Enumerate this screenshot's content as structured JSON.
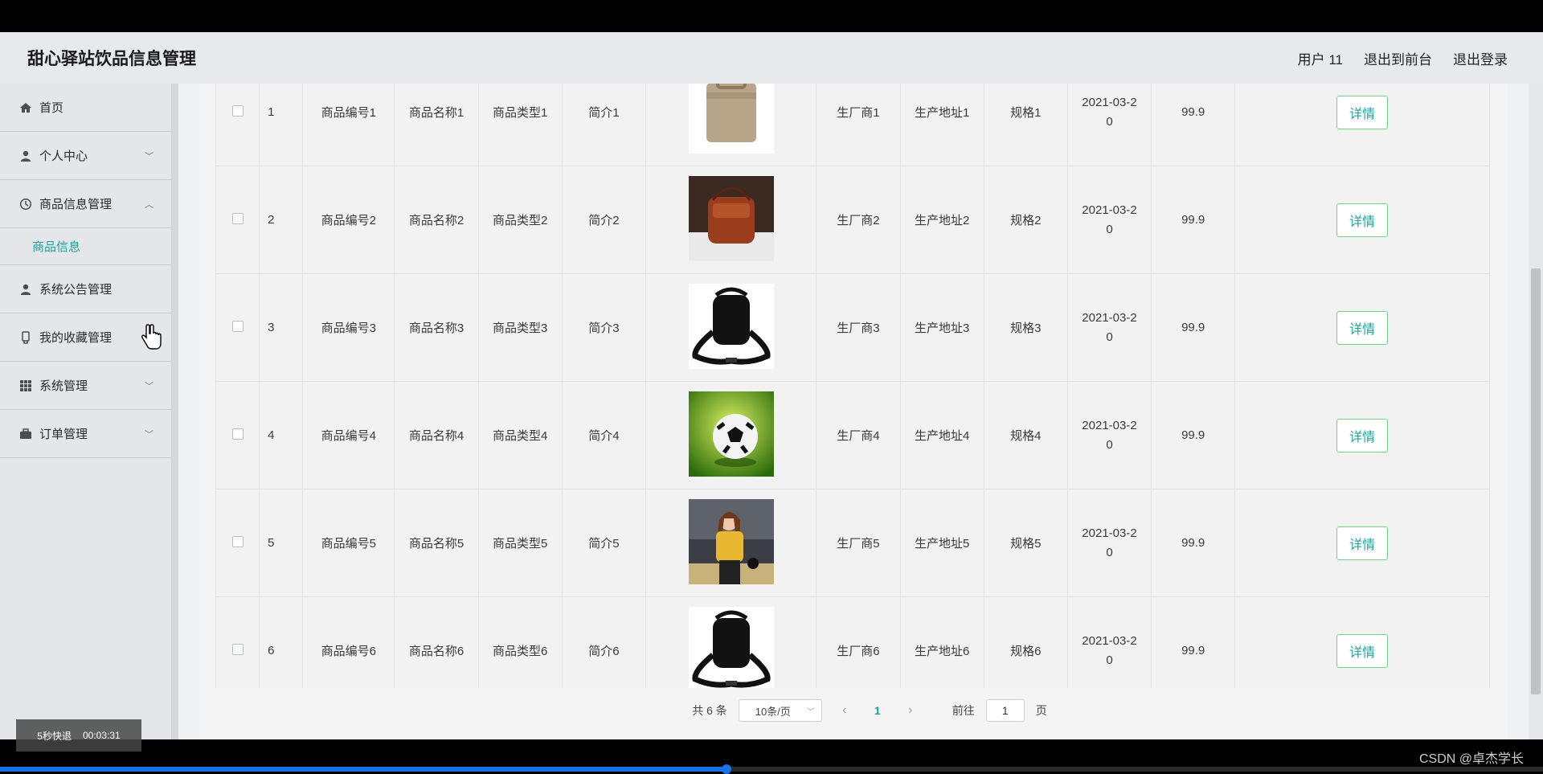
{
  "header": {
    "title": "甜心驿站饮品信息管理",
    "user": "用户 11",
    "to_front": "退出到前台",
    "logout": "退出登录"
  },
  "sidebar": {
    "items": [
      {
        "label": "首页",
        "icon": "home-icon"
      },
      {
        "label": "个人中心",
        "icon": "user-icon"
      },
      {
        "label": "商品信息管理",
        "icon": "clock-icon",
        "sub": "商品信息"
      },
      {
        "label": "系统公告管理",
        "icon": "user-icon"
      },
      {
        "label": "我的收藏管理",
        "icon": "bookmark-icon"
      },
      {
        "label": "系统管理",
        "icon": "grid-icon"
      },
      {
        "label": "订单管理",
        "icon": "briefcase-icon"
      }
    ]
  },
  "table": {
    "rows": [
      {
        "index": "1",
        "code": "商品编号1",
        "name": "商品名称1",
        "type": "商品类型1",
        "intro": "简介1",
        "image": "beige-bag",
        "maker": "生厂商1",
        "address": "生产地址1",
        "spec": "规格1",
        "date_a": "2021-03-2",
        "date_b": "0",
        "price": "99.9",
        "action": "详情"
      },
      {
        "index": "2",
        "code": "商品编号2",
        "name": "商品名称2",
        "type": "商品类型2",
        "intro": "简介2",
        "image": "brown-bag",
        "maker": "生厂商2",
        "address": "生产地址2",
        "spec": "规格2",
        "date_a": "2021-03-2",
        "date_b": "0",
        "price": "99.9",
        "action": "详情"
      },
      {
        "index": "3",
        "code": "商品编号3",
        "name": "商品名称3",
        "type": "商品类型3",
        "intro": "简介3",
        "image": "black-bag",
        "maker": "生厂商3",
        "address": "生产地址3",
        "spec": "规格3",
        "date_a": "2021-03-2",
        "date_b": "0",
        "price": "99.9",
        "action": "详情"
      },
      {
        "index": "4",
        "code": "商品编号4",
        "name": "商品名称4",
        "type": "商品类型4",
        "intro": "简介4",
        "image": "soccer-ball",
        "maker": "生厂商4",
        "address": "生产地址4",
        "spec": "规格4",
        "date_a": "2021-03-2",
        "date_b": "0",
        "price": "99.9",
        "action": "详情"
      },
      {
        "index": "5",
        "code": "商品编号5",
        "name": "商品名称5",
        "type": "商品类型5",
        "intro": "简介5",
        "image": "woman-photo",
        "maker": "生厂商5",
        "address": "生产地址5",
        "spec": "规格5",
        "date_a": "2021-03-2",
        "date_b": "0",
        "price": "99.9",
        "action": "详情"
      },
      {
        "index": "6",
        "code": "商品编号6",
        "name": "商品名称6",
        "type": "商品类型6",
        "intro": "简介6",
        "image": "black-bag",
        "maker": "生厂商6",
        "address": "生产地址6",
        "spec": "规格6",
        "date_a": "2021-03-2",
        "date_b": "0",
        "price": "99.9",
        "action": "详情"
      }
    ]
  },
  "pager": {
    "total": "共 6 条",
    "page_size": "10条/页",
    "current": "1",
    "goto_label": "前往",
    "goto_value": "1",
    "page_unit": "页"
  },
  "overlay": {
    "rewind": "5秒快退",
    "time": "00:03:31",
    "watermark": "CSDN @卓杰学长"
  }
}
